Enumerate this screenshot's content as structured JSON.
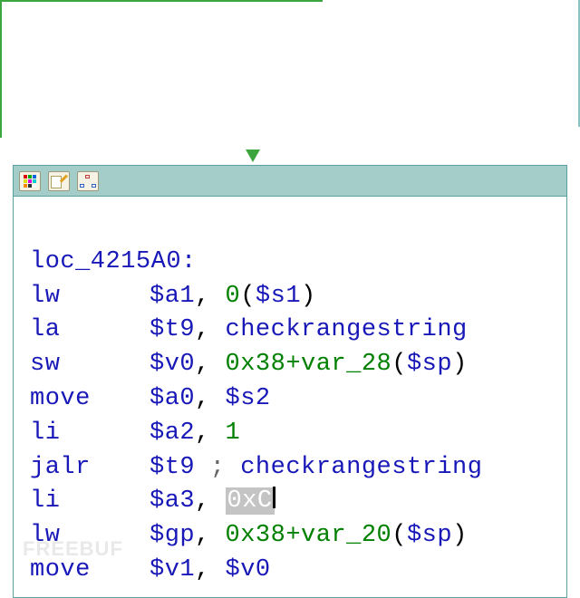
{
  "block": {
    "label": "loc_4215A0:",
    "instructions": [
      {
        "mnemonic": "lw",
        "tokens": [
          {
            "t": "reg",
            "v": "$a1"
          },
          {
            "t": "comma",
            "v": ", "
          },
          {
            "t": "num",
            "v": "0"
          },
          {
            "t": "punct",
            "v": "("
          },
          {
            "t": "reg",
            "v": "$s1"
          },
          {
            "t": "punct",
            "v": ")"
          }
        ]
      },
      {
        "mnemonic": "la",
        "tokens": [
          {
            "t": "reg",
            "v": "$t9"
          },
          {
            "t": "comma",
            "v": ", "
          },
          {
            "t": "func",
            "v": "checkrangestring"
          }
        ]
      },
      {
        "mnemonic": "sw",
        "tokens": [
          {
            "t": "reg",
            "v": "$v0"
          },
          {
            "t": "comma",
            "v": ", "
          },
          {
            "t": "expr",
            "v": "0x38+var_28"
          },
          {
            "t": "punct",
            "v": "("
          },
          {
            "t": "reg",
            "v": "$sp"
          },
          {
            "t": "punct",
            "v": ")"
          }
        ]
      },
      {
        "mnemonic": "move",
        "tokens": [
          {
            "t": "reg",
            "v": "$a0"
          },
          {
            "t": "comma",
            "v": ", "
          },
          {
            "t": "reg",
            "v": "$s2"
          }
        ]
      },
      {
        "mnemonic": "li",
        "tokens": [
          {
            "t": "reg",
            "v": "$a2"
          },
          {
            "t": "comma",
            "v": ", "
          },
          {
            "t": "num",
            "v": "1"
          }
        ]
      },
      {
        "mnemonic": "jalr",
        "tokens": [
          {
            "t": "reg",
            "v": "$t9"
          },
          {
            "t": "comment",
            "v": " ; "
          },
          {
            "t": "func",
            "v": "checkrangestring"
          }
        ]
      },
      {
        "mnemonic": "li",
        "tokens": [
          {
            "t": "reg",
            "v": "$a3"
          },
          {
            "t": "comma",
            "v": ", "
          },
          {
            "t": "hl",
            "v": "0xC"
          },
          {
            "t": "cursor",
            "v": ""
          }
        ]
      },
      {
        "mnemonic": "lw",
        "tokens": [
          {
            "t": "reg",
            "v": "$gp"
          },
          {
            "t": "comma",
            "v": ", "
          },
          {
            "t": "expr",
            "v": "0x38+var_20"
          },
          {
            "t": "punct",
            "v": "("
          },
          {
            "t": "reg",
            "v": "$sp"
          },
          {
            "t": "punct",
            "v": ")"
          }
        ]
      },
      {
        "mnemonic": "move",
        "tokens": [
          {
            "t": "reg",
            "v": "$v1"
          },
          {
            "t": "comma",
            "v": ", "
          },
          {
            "t": "reg",
            "v": "$v0"
          }
        ]
      }
    ]
  },
  "toolbar": {
    "buttons": [
      {
        "name": "palette-icon"
      },
      {
        "name": "edit-note-icon"
      },
      {
        "name": "graph-view-icon"
      }
    ]
  },
  "watermark": "FREEBUF"
}
